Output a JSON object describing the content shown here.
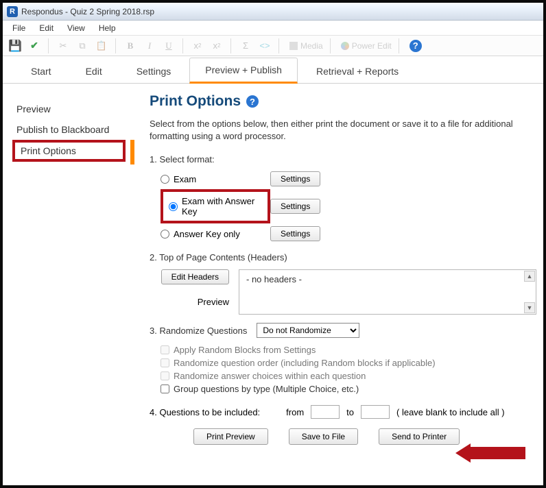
{
  "title": "Respondus - Quiz 2 Spring 2018.rsp",
  "menu": {
    "file": "File",
    "edit": "Edit",
    "view": "View",
    "help": "Help"
  },
  "toolbar": {
    "media": "Media",
    "power_edit": "Power Edit"
  },
  "tabs": {
    "start": "Start",
    "edit": "Edit",
    "settings": "Settings",
    "preview_publish": "Preview + Publish",
    "retrieval_reports": "Retrieval + Reports"
  },
  "sidebar": {
    "preview": "Preview",
    "publish": "Publish to Blackboard",
    "print_options": "Print Options"
  },
  "page": {
    "heading": "Print Options",
    "desc": "Select from the options below, then either print the document or save it to a file for additional formatting using a word processor.",
    "sec1": "1.  Select format:",
    "fmt_exam": "Exam",
    "fmt_exam_key": "Exam with Answer Key",
    "fmt_key_only": "Answer Key only",
    "settings_btn": "Settings",
    "sec2": "2.  Top of Page Contents (Headers)",
    "edit_headers": "Edit Headers",
    "preview_label": "Preview",
    "no_headers": "- no headers -",
    "sec3": "3.  Randomize Questions",
    "rand_option": "Do not Randomize",
    "chk_blocks": "Apply Random Blocks from Settings",
    "chk_order": "Randomize question order (including Random blocks if applicable)",
    "chk_answers": "Randomize answer choices within each question",
    "chk_group": "Group questions by type (Multiple Choice, etc.)",
    "sec4": "4.  Questions to be included:",
    "from": "from",
    "to": "to",
    "leave_blank": "( leave blank to include all )",
    "print_preview": "Print Preview",
    "save_to_file": "Save to File",
    "send_to_printer": "Send to Printer"
  }
}
